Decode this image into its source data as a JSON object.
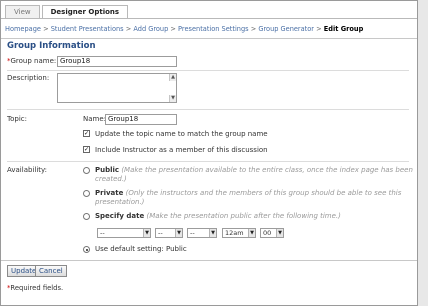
{
  "tabs": {
    "view": "View",
    "designer": "Designer Options"
  },
  "breadcrumb": {
    "items": [
      "Homepage",
      "Student Presentations",
      "Add Group",
      "Presentation Settings",
      "Group Generator"
    ],
    "separator": ">",
    "current": "Edit Group"
  },
  "section": {
    "title": "Group Information"
  },
  "fields": {
    "group_name_label": "Group name:",
    "group_name_value": "Group18",
    "description_label": "Description:",
    "topic_label": "Topic:",
    "topic_name_label": "Name:",
    "topic_name_value": "Group18",
    "update_topic_label": "Update the topic name to match the group name",
    "include_instructor_label": "Include Instructor as a member of this discussion"
  },
  "availability": {
    "label": "Availability:",
    "public_label": "Public",
    "public_hint_1": "(Make the presentation available to the entire class, once the index page has been",
    "public_hint_2": "created.)",
    "private_label": "Private",
    "private_hint_1": "(Only the instructors and the members of this group should be able to see this",
    "private_hint_2": "presentation.)",
    "specify_label": "Specify date",
    "specify_hint": "(Make the presentation public after the following time.)",
    "date_selects": [
      "--",
      "--",
      "--",
      "12am",
      "00"
    ],
    "default_label": "Use default setting: Public"
  },
  "buttons": {
    "update": "Update",
    "cancel": "Cancel"
  },
  "footer": {
    "required_note": "Required fields."
  },
  "colors": {
    "link": "#4a6fa5",
    "title": "#2a4f86",
    "required": "#cc0000"
  }
}
